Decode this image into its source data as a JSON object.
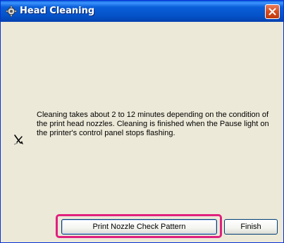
{
  "window": {
    "title": "Head Cleaning",
    "title_icon": "printer-gear-icon",
    "close_icon": "close-icon"
  },
  "message": {
    "icon": "pen-nib-icon",
    "text": "Cleaning takes about 2 to 12 minutes depending on the condition of the print head nozzles. Cleaning is finished when the Pause light on the printer's control panel stops flashing."
  },
  "buttons": {
    "print_nozzle_check": "Print Nozzle Check Pattern",
    "finish": "Finish"
  },
  "colors": {
    "titlebar": "#0a5fd8",
    "client_background": "#ece9d8",
    "highlight": "#e0207e"
  }
}
